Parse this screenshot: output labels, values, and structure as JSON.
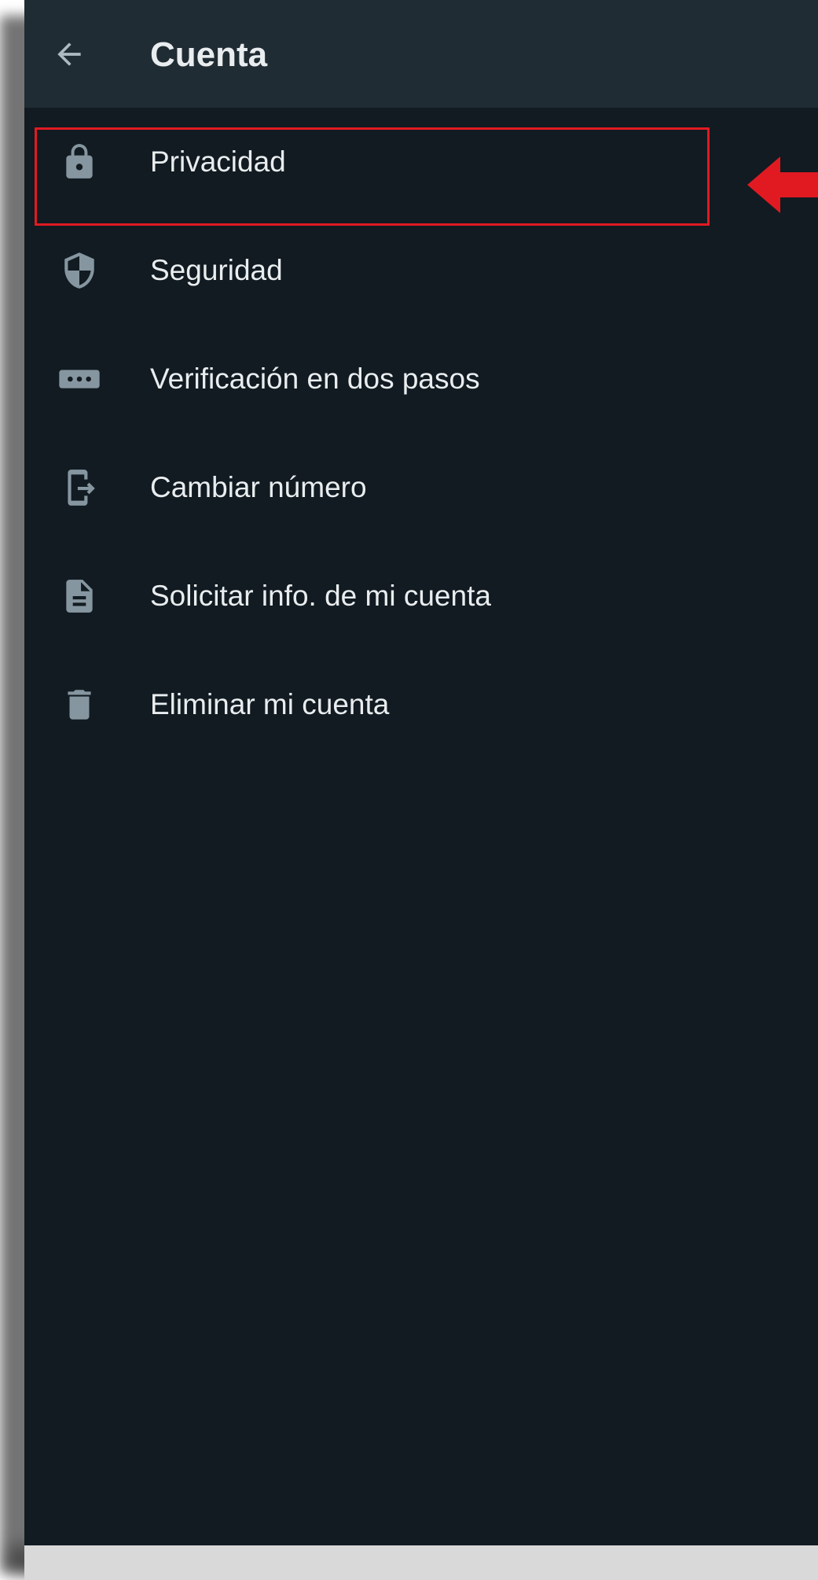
{
  "header": {
    "title": "Cuenta",
    "back_icon": "arrow-left-icon"
  },
  "menu": {
    "items": [
      {
        "label": "Privacidad",
        "icon": "lock-icon"
      },
      {
        "label": "Seguridad",
        "icon": "shield-icon"
      },
      {
        "label": "Verificación en dos pasos",
        "icon": "password-dots-icon"
      },
      {
        "label": "Cambiar número",
        "icon": "phone-transfer-icon"
      },
      {
        "label": "Solicitar info. de mi cuenta",
        "icon": "document-icon"
      },
      {
        "label": "Eliminar mi cuenta",
        "icon": "trash-icon"
      }
    ]
  },
  "annotation": {
    "highlight_color": "#e11a22",
    "arrow_icon": "red-arrow-left-icon"
  },
  "colors": {
    "background": "#111b21",
    "app_bar": "#202c33",
    "text": "#e9edef",
    "icon": "#8696a0"
  }
}
